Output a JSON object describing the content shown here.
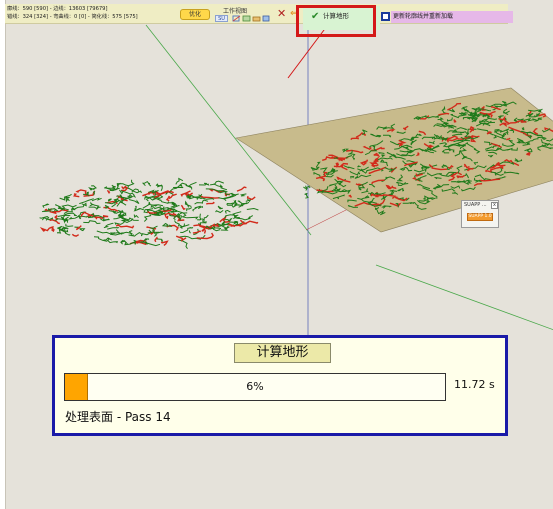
{
  "toolbar": {
    "stat_line1": "廓线：590 [590] - 边线：13603 [79679]",
    "stat_line2": "错线：324 [324] - 弯曲线：0 [0] - 简化线：575 [575]",
    "optimize_label": "优化",
    "workview_label": "工作视图",
    "su_label": "SU",
    "calc_terrain_label": "计算地形",
    "update_contours_label": "更新轮廓线并重新加载"
  },
  "suapp": {
    "title": "SUAPP ...",
    "close": "x",
    "button_label": "SUAPP 1.0"
  },
  "progress": {
    "title": "计算地形",
    "percent_text": "6%",
    "fraction": 0.06,
    "time": "11.72 s",
    "status": "处理表面 - Pass 14"
  },
  "colors": {
    "viewport_bg": "#e5e2da",
    "dialog_border": "#1a1aa8",
    "progress_fill": "#ffa500",
    "highlight_red": "#d41818",
    "contour_green": "#1f7a1a",
    "contour_red": "#d22a1a"
  }
}
